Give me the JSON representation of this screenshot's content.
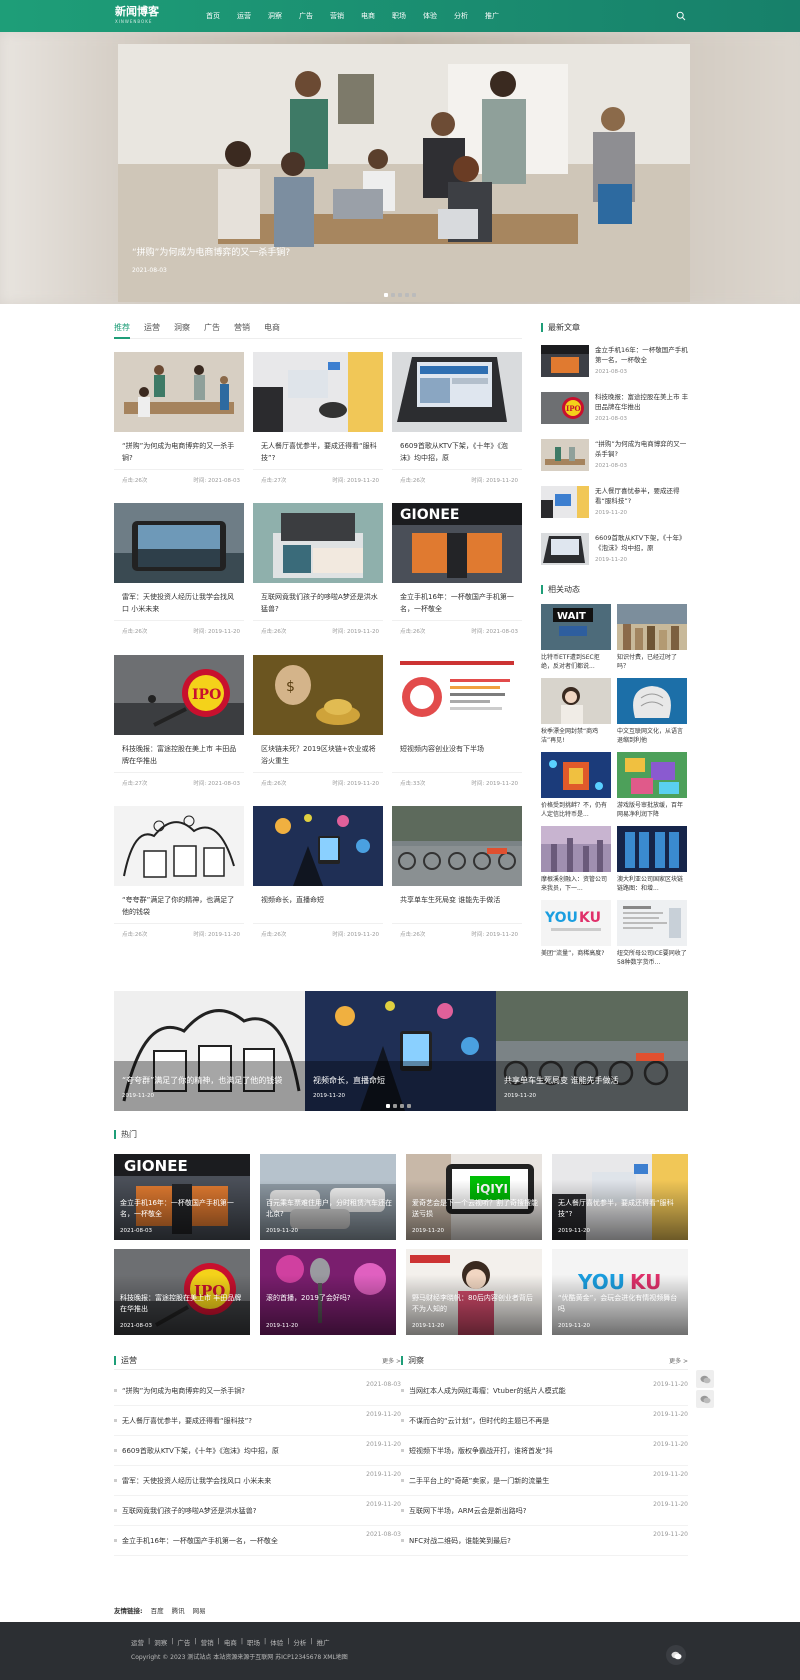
{
  "header": {
    "logo": "新闻博客",
    "logo_sub": "XINWENBOKE",
    "nav": [
      "首页",
      "运营",
      "洞察",
      "广告",
      "营销",
      "电商",
      "职场",
      "体验",
      "分析",
      "推广"
    ]
  },
  "hero": {
    "title": "“拼购”为何成为电商博弈的又一杀手锏?",
    "date": "2021-08-03"
  },
  "tabs": [
    "推荐",
    "运营",
    "洞察",
    "广告",
    "营销",
    "电商"
  ],
  "cards": [
    {
      "title": "“拼购”为何成为电商博弈的又一杀手锏?",
      "views": "点击:26次",
      "time": "时间: 2021-08-03"
    },
    {
      "title": "无人餐厅喜忧参半，要成还得看“服科技”?",
      "views": "点击:27次",
      "time": "时间: 2019-11-20"
    },
    {
      "title": "6609首歌从KTV下架，《十年》《泡沫》均中招，原",
      "views": "点击:26次",
      "time": "时间: 2019-11-20"
    },
    {
      "title": "雷军：天使投资人经历让我学会找风口 小米未来",
      "views": "点击:26次",
      "time": "时间: 2019-11-20"
    },
    {
      "title": "互联网竟我们孩子的哆啦A梦还是洪水猛兽?",
      "views": "点击:26次",
      "time": "时间: 2019-11-20"
    },
    {
      "title": "金立手机16年：一杯敬国产手机第一名，一杯敬全",
      "views": "点击:26次",
      "time": "时间: 2021-08-03"
    },
    {
      "title": "科技晚报：富途控股在美上市 丰田品牌在华推出",
      "views": "点击:27次",
      "time": "时间: 2021-08-03"
    },
    {
      "title": "区块链未死？2019区块链+农业或将浴火重生",
      "views": "点击:26次",
      "time": "时间: 2019-11-20"
    },
    {
      "title": "短视频内容创业没有下半场",
      "views": "点击:33次",
      "time": "时间: 2019-11-20"
    },
    {
      "title": "“夸夸群”满足了你的精神，也满足了他的钱袋",
      "views": "点击:26次",
      "time": "时间: 2019-11-20"
    },
    {
      "title": "视频命长，直播命短",
      "views": "点击:26次",
      "time": "时间: 2019-11-20"
    },
    {
      "title": "共享单车生死局变 谁能先手做活",
      "views": "点击:26次",
      "time": "时间: 2019-11-20"
    }
  ],
  "sidebar": {
    "latest_title": "最新文章",
    "latest": [
      {
        "title": "金立手机16年：一杯敬国产手机第一名，一杯敬全",
        "date": "2021-08-03"
      },
      {
        "title": "科技晚报：富途控股在美上市 丰田品牌在华推出",
        "date": "2021-08-03"
      },
      {
        "title": "“拼购”为何成为电商博弈的又一杀手锏?",
        "date": "2021-08-03"
      },
      {
        "title": "无人餐厅喜忧参半，要成还得看“服科技”?",
        "date": "2019-11-20"
      },
      {
        "title": "6609首歌从KTV下架，《十年》《泡沫》均中招，原",
        "date": "2019-11-20"
      }
    ],
    "dyn_title": "相关动态",
    "dyn": [
      "比特币ETF遭到SEC拒绝，反对者们都说...",
      "知识付费，已经过时了吗？",
      "秋季漂全网封禁“商鸡洁”再见!",
      "中文互联网文化，从语言退缩到利他",
      "价格受到挑衅？不，仍有人定信比特币是...",
      "游戏版号审批放缓，百年网易净利润下降",
      "摩根溪创融入：资管公司来我员，下一...",
      "澳大利亚公司国家区块链链路图：和增...",
      "美团“流量”，商稀高度?",
      "纽交所母公司ICE要同收了58种数字货币..."
    ]
  },
  "banner2": [
    {
      "title": "“夸夸群”满足了你的精神，也满足了他的钱袋",
      "date": "2019-11-20"
    },
    {
      "title": "视频命长，直播命短",
      "date": "2019-11-20"
    },
    {
      "title": "共享单车生死局变 谁能先手做活",
      "date": "2019-11-20"
    }
  ],
  "hot": {
    "title": "热门",
    "items": [
      {
        "title": "金立手机16年：一杯敬国产手机第一名，一杯敬全",
        "date": "2021-08-03"
      },
      {
        "title": "百元乘车票难住用户，分时租赁汽车还在北京?",
        "date": "2019-11-20"
      },
      {
        "title": "爱奇艺会是下一个云视听？割了奇搜搜能送亏损",
        "date": "2019-11-20"
      },
      {
        "title": "无人餐厅喜忧参半，要成还得看“服科技”?",
        "date": "2019-11-20"
      },
      {
        "title": "科技晚报：富途控股在美上市 丰田品牌在华推出",
        "date": "2021-08-03"
      },
      {
        "title": "滚的首播，2019了会好吗?",
        "date": "2019-11-20"
      },
      {
        "title": "野马财经李晓帆：80后内容创业者背后不为人知的",
        "date": "2019-11-20"
      },
      {
        "title": "“优酷黄金”，会玩会进化有情视频舞台吗",
        "date": "2019-11-20"
      }
    ]
  },
  "lists": [
    {
      "title": "运营",
      "more": "更多 >",
      "items": [
        {
          "title": "“拼购”为何成为电商博弈的又一杀手锏?",
          "date": "2021-08-03"
        },
        {
          "title": "无人餐厅喜忧参半，要成还得看“服科技”?",
          "date": "2019-11-20"
        },
        {
          "title": "6609首歌从KTV下架，《十年》《泡沫》均中招，原",
          "date": "2019-11-20"
        },
        {
          "title": "雷军：天使投资人经历让我学会找风口 小米未来",
          "date": "2019-11-20"
        },
        {
          "title": "互联网竟我们孩子的哆啦A梦还是洪水猛兽?",
          "date": "2019-11-20"
        },
        {
          "title": "金立手机16年：一杯敬国产手机第一名，一杯敬全",
          "date": "2021-08-03"
        }
      ]
    },
    {
      "title": "洞察",
      "more": "更多 >",
      "items": [
        {
          "title": "当网红本人成为网红毒瘤：Vtuber的纸片人模式能",
          "date": "2019-11-20"
        },
        {
          "title": "不谋而合的“云计划”，但时代的主题已不再是",
          "date": "2019-11-20"
        },
        {
          "title": "短视频下半场，版权争霸战开打，谁将首发“抖",
          "date": "2019-11-20"
        },
        {
          "title": "二手平台上的“奇葩”卖家，是一门新的流量生",
          "date": "2019-11-20"
        },
        {
          "title": "互联网下半场，ARM云会是新出路吗?",
          "date": "2019-11-20"
        },
        {
          "title": "NFC对战二维码，谁能笑到最后?",
          "date": "2019-11-20"
        }
      ]
    }
  ],
  "friend": {
    "label": "友情链接:",
    "links": [
      "百度",
      "腾讯",
      "网易"
    ]
  },
  "footer": {
    "nav": [
      "运营",
      "|",
      "洞察",
      "|",
      "广告",
      "|",
      "营销",
      "|",
      "电商",
      "|",
      "职场",
      "|",
      "体验",
      "|",
      "分析",
      "|",
      "推广"
    ],
    "copyright": "Copyright © 2023 测试站点 本站资源来源于互联网 苏ICP12345678 XML地图"
  }
}
